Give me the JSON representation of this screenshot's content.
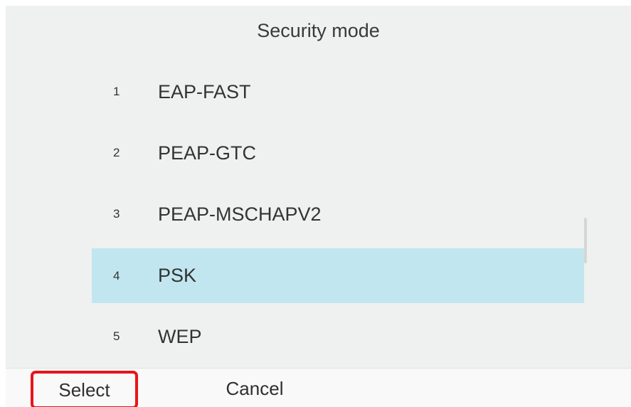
{
  "header": {
    "title": "Security mode"
  },
  "menu": {
    "items": [
      {
        "number": "1",
        "label": "EAP-FAST",
        "selected": false
      },
      {
        "number": "2",
        "label": "PEAP-GTC",
        "selected": false
      },
      {
        "number": "3",
        "label": "PEAP-MSCHAPV2",
        "selected": false
      },
      {
        "number": "4",
        "label": "PSK",
        "selected": true
      },
      {
        "number": "5",
        "label": "WEP",
        "selected": false
      }
    ]
  },
  "softkeys": {
    "select_label": "Select",
    "cancel_label": "Cancel"
  },
  "colors": {
    "background": "#eef1ef",
    "selected_row": "#c1e6ef",
    "highlight_border": "#e8141c"
  }
}
